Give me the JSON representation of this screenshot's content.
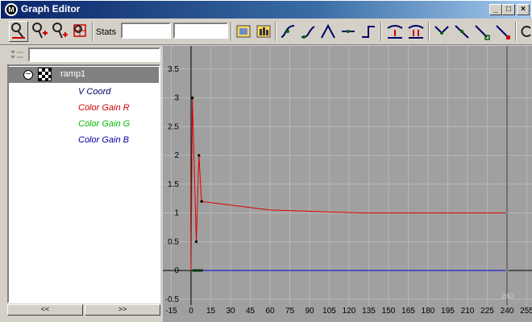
{
  "window": {
    "title": "Graph Editor",
    "app_badge": "M",
    "controls": {
      "minimize": "_",
      "maximize": "□",
      "close": "×"
    }
  },
  "toolbar": {
    "stats_label": "Stats",
    "stats_value_1": "",
    "stats_value_2": "",
    "tools": [
      "move-key-tool-icon",
      "add-key-tool-icon",
      "insert-key-tool-icon",
      "lattice-deform-tool-icon",
      "frame-all-icon",
      "frame-playback-range-icon",
      "spline-tangents-icon",
      "clamped-tangents-icon",
      "linear-tangents-icon",
      "flat-tangents-icon",
      "stepped-tangents-icon",
      "buffer-curve-snapshot-icon",
      "swap-buffer-curves-icon",
      "break-tangents-icon",
      "unify-tangents-icon",
      "free-tangent-weight-icon",
      "lock-tangent-weight-icon",
      "cycle-icon"
    ]
  },
  "outliner": {
    "search_value": "",
    "node": {
      "name": "ramp1",
      "expanded": true
    },
    "attributes": [
      {
        "label": "V Coord",
        "color": "#000066"
      },
      {
        "label": "Color Gain R",
        "color": "#cc0000"
      },
      {
        "label": "Color Gain G",
        "color": "#00bb00"
      },
      {
        "label": "Color Gain B",
        "color": "#0000aa"
      }
    ],
    "scroll_left": "<<",
    "scroll_right": ">>"
  },
  "graph": {
    "background": "#a0a0a0",
    "grid_color": "#b8b8b8",
    "x_ticks": [
      "-15",
      "0",
      "15",
      "30",
      "45",
      "60",
      "75",
      "90",
      "105",
      "120",
      "135",
      "150",
      "165",
      "180",
      "195",
      "210",
      "225",
      "240",
      "255"
    ],
    "y_ticks": [
      "3.5",
      "3",
      "2.5",
      "2",
      "1.5",
      "1",
      "0.5",
      "0",
      "-0.5"
    ],
    "current_frame": "240",
    "curves": {
      "color_gain_r": {
        "color": "#dd0000",
        "keys": [
          [
            1,
            3
          ],
          [
            4,
            0.5
          ],
          [
            6,
            2
          ],
          [
            8,
            1.2
          ]
        ],
        "tail": [
          [
            8,
            1.2
          ],
          [
            60,
            1.05
          ],
          [
            130,
            1.0
          ],
          [
            240,
            1.0
          ]
        ]
      },
      "color_gain_b": {
        "color": "#0000cc",
        "keys": [
          [
            1,
            0
          ],
          [
            240,
            0
          ]
        ]
      },
      "keys_at_zero": [
        [
          2,
          0
        ],
        [
          4,
          0
        ],
        [
          6,
          0
        ],
        [
          8,
          0
        ]
      ]
    }
  }
}
